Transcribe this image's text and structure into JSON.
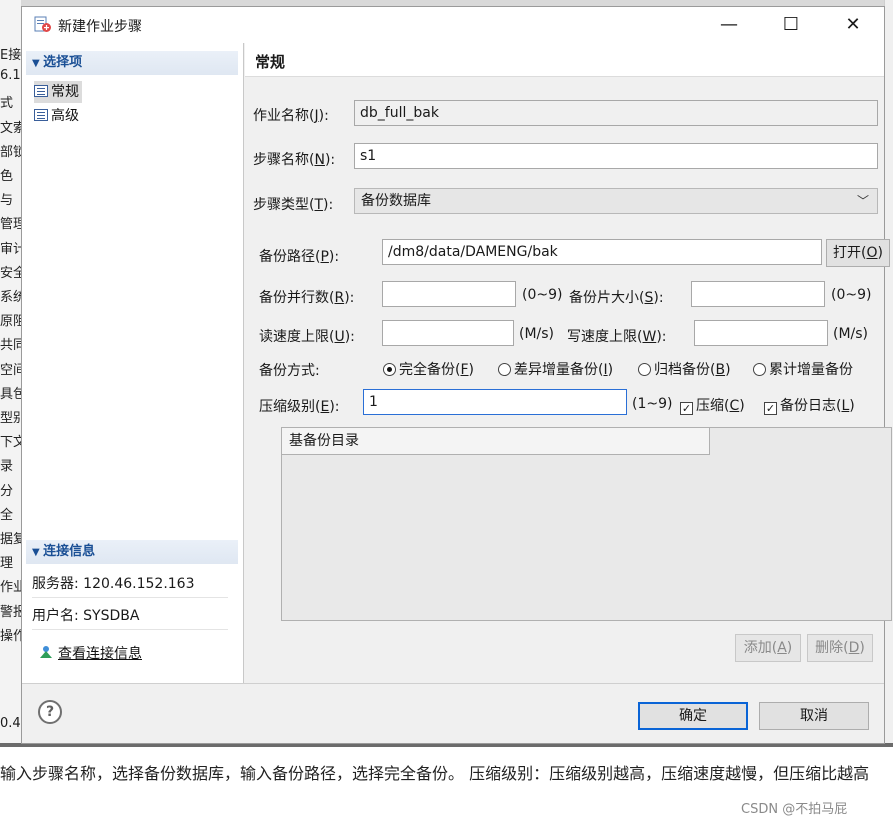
{
  "background": {
    "left_fragments": [
      "E接",
      "6.1",
      "式",
      "文索",
      "部锁",
      "色",
      "与",
      "管理",
      "审计",
      "安全",
      "系统",
      "原阻",
      "共同",
      "空间",
      "具包",
      "型别",
      "下文",
      "录",
      "分",
      "全",
      "据复",
      "理",
      "作业",
      "警报",
      "操作"
    ],
    "bottom_left_fragment": "0.4"
  },
  "dialog": {
    "title": "新建作业步骤",
    "minimize": "—",
    "maximize": "☐",
    "close": "✕",
    "left_nav": {
      "options_header": "选择项",
      "items": [
        {
          "label": "常规",
          "selected": true
        },
        {
          "label": "高级",
          "selected": false
        }
      ],
      "connection_header": "连接信息",
      "server_label": "服务器: 120.46.152.163",
      "user_label": "用户名: SYSDBA",
      "view_link": "查看连接信息"
    },
    "panel": {
      "title": "常规",
      "job_name": {
        "label_prefix": "作业名称(",
        "key": "J",
        "label_suffix": "):",
        "value": "db_full_bak"
      },
      "step_name": {
        "label_prefix": "步骤名称(",
        "key": "N",
        "label_suffix": "):",
        "value": "s1"
      },
      "step_type": {
        "label_prefix": "步骤类型(",
        "key": "T",
        "label_suffix": "):",
        "value": "备份数据库"
      },
      "backup_path": {
        "label_prefix": "备份路径(",
        "key": "P",
        "label_suffix": "):",
        "value": "/dm8/data/DAMENG/bak",
        "open_prefix": "打开(",
        "open_key": "O",
        "open_suffix": ")"
      },
      "parallel": {
        "label_prefix": "备份并行数(",
        "key": "R",
        "label_suffix": "):",
        "value": "",
        "range": "(0~9)"
      },
      "piece_size": {
        "label_prefix": "备份片大小(",
        "key": "S",
        "label_suffix": "):",
        "value": "",
        "range": "(0~9)"
      },
      "read_limit": {
        "label_prefix": "读速度上限(",
        "key": "U",
        "label_suffix": "):",
        "value": "",
        "unit": "(M/s)"
      },
      "write_limit": {
        "label_prefix": "写速度上限(",
        "key": "W",
        "label_suffix": "):",
        "value": "",
        "unit": "(M/s)"
      },
      "backup_mode": {
        "label": "备份方式:",
        "options": [
          {
            "prefix": "完全备份(",
            "key": "F",
            "suffix": ")",
            "checked": true
          },
          {
            "prefix": "差异增量备份(",
            "key": "I",
            "suffix": ")",
            "checked": false
          },
          {
            "prefix": "归档备份(",
            "key": "B",
            "suffix": ")",
            "checked": false
          },
          {
            "prefix": "累计增量备份",
            "key": "",
            "suffix": "",
            "checked": false
          }
        ]
      },
      "compress_level": {
        "label_prefix": "压缩级别(",
        "key": "E",
        "label_suffix": "):",
        "value": "1",
        "range": "(1~9)"
      },
      "compress": {
        "prefix": "压缩(",
        "key": "C",
        "suffix": ")",
        "checked": true
      },
      "backup_log": {
        "prefix": "备份日志(",
        "key": "L",
        "suffix": ")",
        "checked": true
      },
      "base_dir_header": "基备份目录",
      "add": {
        "prefix": "添加(",
        "key": "A",
        "suffix": ")"
      },
      "delete": {
        "prefix": "删除(",
        "key": "D",
        "suffix": ")"
      }
    },
    "footer": {
      "help": "?",
      "ok": "确定",
      "cancel": "取消"
    }
  },
  "caption": {
    "text": "输入步骤名称，选择备份数据库，输入备份路径，选择完全备份。 压缩级别：压缩级别越高，压缩速度越慢，但压缩比越高",
    "watermark": "CSDN @不拍马屁"
  },
  "colors": {
    "accent": "#0a64d6",
    "section_header_text": "#1a4f95",
    "dialog_bg": "#f0f0f0"
  }
}
